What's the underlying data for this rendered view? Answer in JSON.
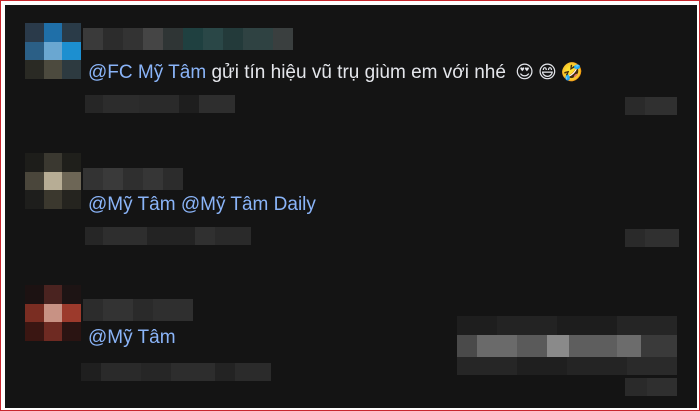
{
  "comments": [
    {
      "mention": "@FC Mỹ Tâm",
      "text": "gửi tín hiệu vũ trụ giùm em với nhé",
      "emojis": [
        "😍",
        "😄",
        "🤣"
      ],
      "avatar": "blurred-avatar",
      "author": "blurred-name"
    },
    {
      "mention": "@Mỹ Tâm @Mỹ Tâm Daily",
      "text": "",
      "emojis": [],
      "avatar": "blurred-avatar",
      "author": "blurred-name"
    },
    {
      "mention": "@Mỹ Tâm",
      "text": "",
      "emojis": [],
      "avatar": "blurred-avatar",
      "author": "blurred-name"
    }
  ],
  "colors": {
    "background": "#141414",
    "text": "#e4e6eb",
    "mention": "#8ab4f8",
    "frame": "#c8272d"
  }
}
